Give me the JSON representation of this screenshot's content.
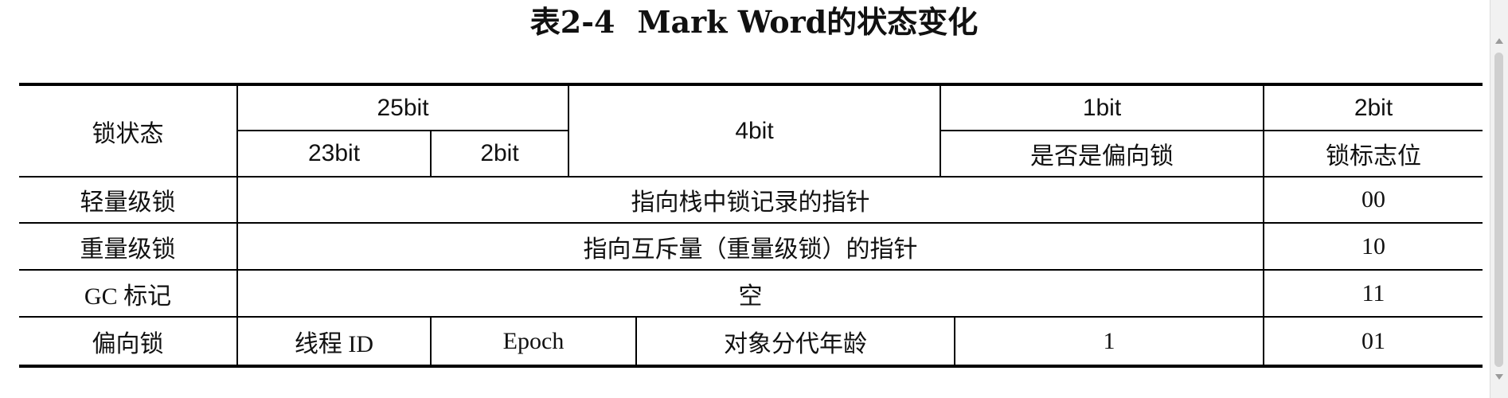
{
  "title": {
    "prefix": "表2-4",
    "text": "Mark Word的状态变化"
  },
  "table": {
    "header": {
      "lock_state": "锁状态",
      "bits_25": "25bit",
      "bits_23": "23bit",
      "bits_2": "2bit",
      "bits_4": "4bit",
      "bits_1": "1bit",
      "is_biased": "是否是偏向锁",
      "bits_2_flag": "2bit",
      "flag": "锁标志位"
    },
    "rows": [
      {
        "state": "轻量级锁",
        "content": "指向栈中锁记录的指针",
        "flag": "00"
      },
      {
        "state": "重量级锁",
        "content": "指向互斥量（重量级锁）的指针",
        "flag": "10"
      },
      {
        "state": "GC 标记",
        "content": "空",
        "flag": "11"
      },
      {
        "state": "偏向锁",
        "thread_id": "线程 ID",
        "epoch": "Epoch",
        "age": "对象分代年龄",
        "biased": "1",
        "flag": "01"
      }
    ]
  }
}
